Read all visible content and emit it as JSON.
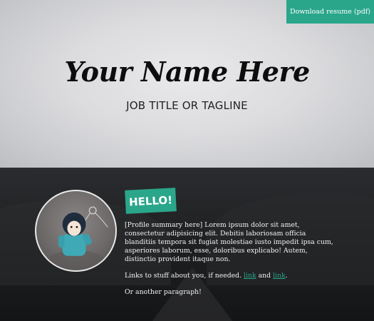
{
  "header": {
    "download_label": "Download resume (pdf)",
    "name": "Your Name Here",
    "tagline": "JOB TITLE OR TAGLINE"
  },
  "profile": {
    "hello_label": "HELLO!",
    "summary": "[Profile summary here] Lorem ipsum dolor sit amet, consectetur adipisicing elit. Debitis laboriosam officia blanditiis tempora sit fugiat molestiae iusto impedit ipsa cum, asperiores laborum, esse, doloribus explicabo! Autem, distinctio provident itaque non.",
    "links_prefix": "Links to stuff about you, if needed.",
    "link1_label": "link",
    "links_and": "and",
    "link2_label": "link",
    "links_suffix": ".",
    "extra_paragraph": "Or another paragraph!"
  },
  "colors": {
    "accent": "#2aa68a",
    "dark_background": "#1a1b1d",
    "hero_background": "#dcdcdf"
  }
}
